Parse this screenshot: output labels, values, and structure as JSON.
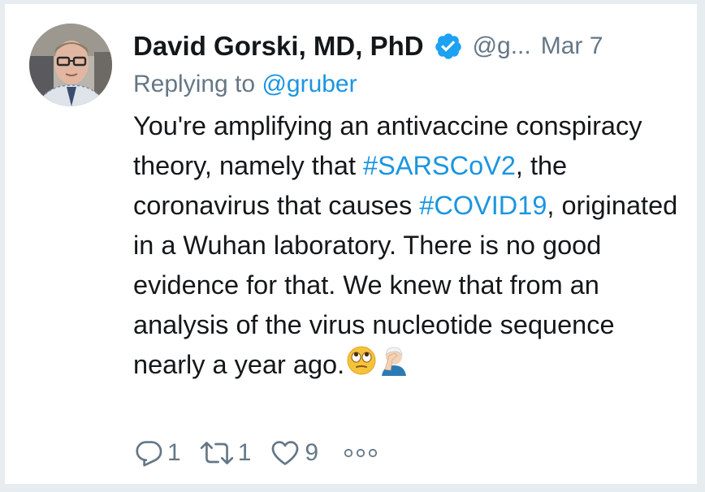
{
  "tweet": {
    "author_name": "David Gorski, MD, PhD",
    "handle": "@g...",
    "date": "Mar 7",
    "verified": true,
    "reply_prefix": "Replying to",
    "reply_to": "@gruber",
    "body": {
      "t1": "You're amplifying an antivaccine conspiracy theory, namely that ",
      "h1": "#SARSCoV2",
      "t2": ", the coronavirus that causes ",
      "h2": "#COVID19",
      "t3": ", originated in a Wuhan laboratory. There is no good evidence for that. We knew that from an analysis of the virus nucleotide sequence nearly a year ago."
    },
    "emojis": [
      "face-with-rolling-eyes",
      "person-facepalming"
    ],
    "actions": {
      "reply_count": "1",
      "retweet_count": "1",
      "like_count": "9"
    }
  },
  "colors": {
    "accent": "#1b95e0",
    "text": "#14171a",
    "muted": "#657786"
  },
  "icons": {
    "verified": "verified-badge-icon",
    "reply": "reply-icon",
    "retweet": "retweet-icon",
    "like": "heart-icon",
    "more": "more-icon"
  }
}
